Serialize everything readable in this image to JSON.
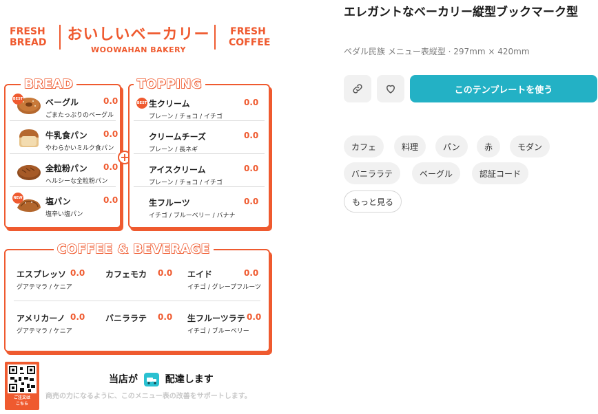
{
  "menu": {
    "header": {
      "left_line1": "FRESH",
      "left_line2": "BREAD",
      "title": "おいしいベーカリー",
      "subtitle": "WOOWAHAN BAKERY",
      "right_line1": "FRESH",
      "right_line2": "COFFEE"
    },
    "bread": {
      "title": "BREAD",
      "items": [
        {
          "name": "ベーグル",
          "desc": "ごまたっぷりのベーグル",
          "price": "0.0",
          "badge": "BEST"
        },
        {
          "name": "牛乳食パン",
          "desc": "やわらかいミルク食パン",
          "price": "0.0",
          "badge": ""
        },
        {
          "name": "全粒粉パン",
          "desc": "ヘルシーな全粒粉パン",
          "price": "0.0",
          "badge": ""
        },
        {
          "name": "塩パン",
          "desc": "塩辛い塩パン",
          "price": "0.0",
          "badge": "NEW"
        }
      ]
    },
    "plus": "+",
    "topping": {
      "title": "TOPPING",
      "items": [
        {
          "name": "生クリーム",
          "desc": "プレーン / チョコ / イチゴ",
          "price": "0.0",
          "badge": "BEST"
        },
        {
          "name": "クリームチーズ",
          "desc": "プレーン / 長ネギ",
          "price": "0.0",
          "badge": ""
        },
        {
          "name": "アイスクリーム",
          "desc": "プレーン / チョコ / イチゴ",
          "price": "0.0",
          "badge": ""
        },
        {
          "name": "生フルーツ",
          "desc": "イチゴ / ブルーベリー / バナナ",
          "price": "0.0",
          "badge": ""
        }
      ]
    },
    "beverage": {
      "title": "COFFEE & BEVERAGE",
      "items": [
        {
          "name": "エスプレッソ",
          "desc": "グアテマラ / ケニア",
          "price": "0.0"
        },
        {
          "name": "カフェモカ",
          "desc": "",
          "price": "0.0"
        },
        {
          "name": "エイド",
          "desc": "イチゴ / グレープフルーツ",
          "price": "0.0"
        },
        {
          "name": "アメリカーノ",
          "desc": "グアテマラ / ケニア",
          "price": "0.0"
        },
        {
          "name": "バニララテ",
          "desc": "",
          "price": "0.0"
        },
        {
          "name": "生フルーツラテ",
          "desc": "イチゴ / ブルーベリー",
          "price": "0.0"
        }
      ]
    },
    "footer": {
      "qr_label_line1": "ご注文は",
      "qr_label_line2": "こちら",
      "deliver_before": "当店が",
      "deliver_after": "配達します",
      "note": "商売の力になるように、このメニュー表の改善をサポートします。"
    }
  },
  "detail": {
    "title": "エレガントなベーカリー縦型ブックマーク型",
    "meta": "ペダル民族 メニュー表縦型 · 297mm × 420mm",
    "link_icon": "link-icon",
    "like_icon": "heart-icon",
    "use_button": "このテンプレートを使う",
    "tags": [
      "カフェ",
      "料理",
      "パン",
      "赤",
      "モダン",
      "バニララテ",
      "ベーグル",
      "認証コード"
    ],
    "more_button": "もっと見る"
  },
  "colors": {
    "accent": "#ef5a2f",
    "brand": "#23b1c5",
    "muted": "#7a7a7a"
  }
}
